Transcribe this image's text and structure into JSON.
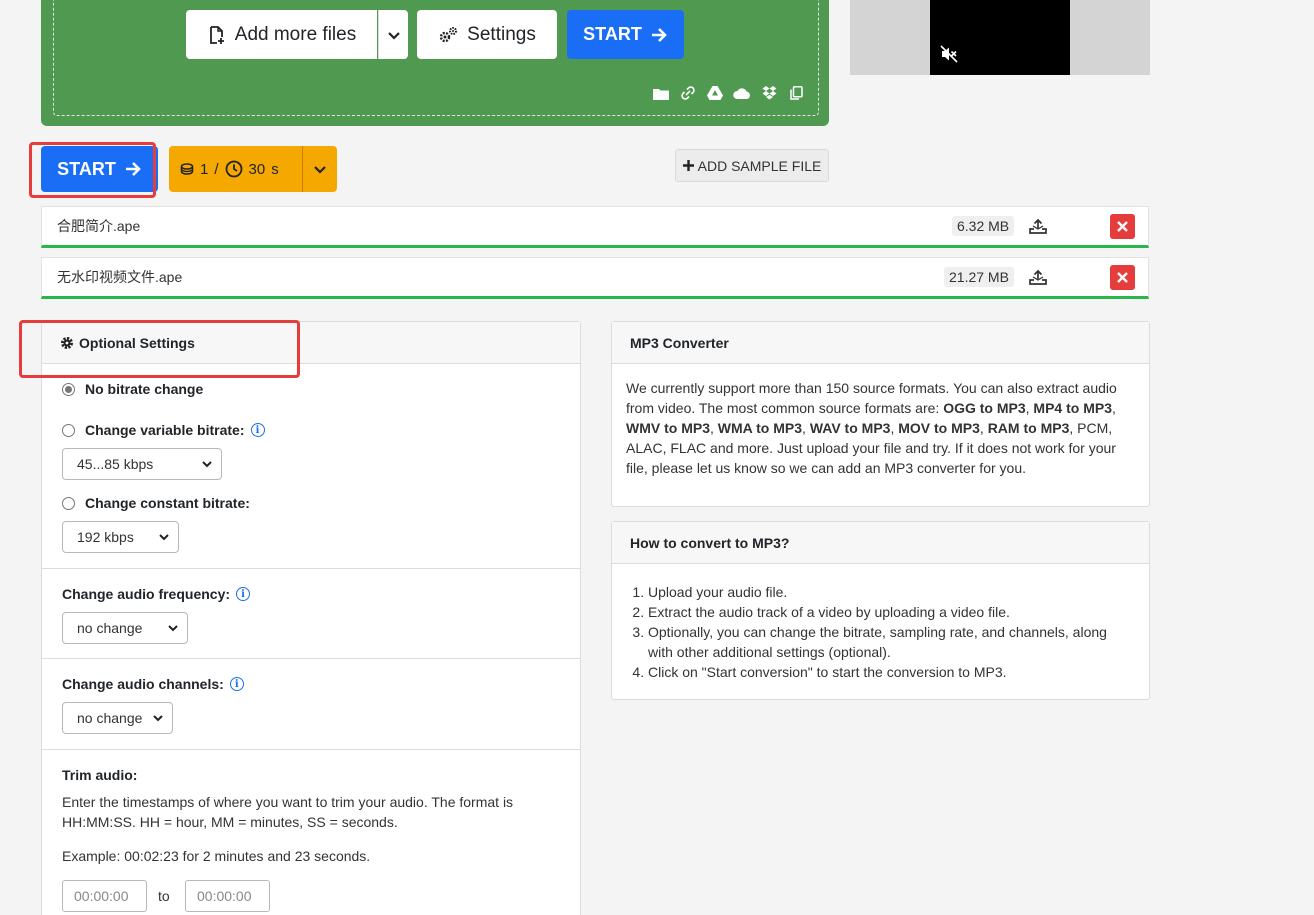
{
  "upload": {
    "add_more_label": "Add more files",
    "settings_label": "Settings",
    "start_label": "START",
    "source_icons": [
      "folder-icon",
      "link-icon",
      "google-drive-icon",
      "onedrive-icon",
      "dropbox-icon",
      "clipboard-icon"
    ]
  },
  "controls": {
    "start_label": "START",
    "credits_count": "1",
    "credits_sep": "/",
    "time_value": "30",
    "time_unit": "s",
    "add_sample_label": "ADD SAMPLE FILE"
  },
  "files": [
    {
      "name": "合肥简介.ape",
      "size": "6.32 MB"
    },
    {
      "name": "无水印视频文件.ape",
      "size": "21.27 MB"
    }
  ],
  "optional_settings": {
    "title": "Optional Settings",
    "no_bitrate": "No bitrate change",
    "variable_bitrate": "Change variable bitrate:",
    "variable_bitrate_value": "45...85 kbps",
    "constant_bitrate": "Change constant bitrate:",
    "constant_bitrate_value": "192 kbps",
    "frequency_label": "Change audio frequency:",
    "frequency_value": "no change",
    "channels_label": "Change audio channels:",
    "channels_value": "no change",
    "trim_label": "Trim audio:",
    "trim_desc": "Enter the timestamps of where you want to trim your audio. The format is HH:MM:SS. HH = hour, MM = minutes, SS = seconds.",
    "trim_example": "Example: 00:02:23 for 2 minutes and 23 seconds.",
    "trim_from_placeholder": "00:00:00",
    "trim_to_label": "to",
    "trim_to_placeholder": "00:00:00"
  },
  "mp3_converter": {
    "title": "MP3 Converter",
    "intro": "We currently support more than 150 source formats. You can also extract audio from video. The most common source formats are: ",
    "formats": [
      "OGG to MP3",
      "MP4 to MP3",
      "WMV to MP3",
      "WMA to MP3",
      "WAV to MP3",
      "MOV to MP3",
      "RAM to MP3"
    ],
    "outro": ", PCM, ALAC, FLAC and more. Just upload your file and try. If it does not work for your file, please let us know so we can add an MP3 converter for you."
  },
  "how_to": {
    "title": "How to convert to MP3?",
    "steps": [
      "Upload your audio file.",
      "Extract the audio track of a video by uploading a video file.",
      "Optionally, you can change the bitrate, sampling rate, and channels, along with other additional settings (optional).",
      "Click on \"Start conversion\" to start the conversion to MP3."
    ]
  },
  "colors": {
    "upload_green": "#4f9a50",
    "primary_blue": "#1a6ef5",
    "credits_orange": "#f5a800",
    "delete_red": "#e53c3c",
    "progress_green": "#29b64b",
    "highlight_red": "#e53c3c"
  }
}
